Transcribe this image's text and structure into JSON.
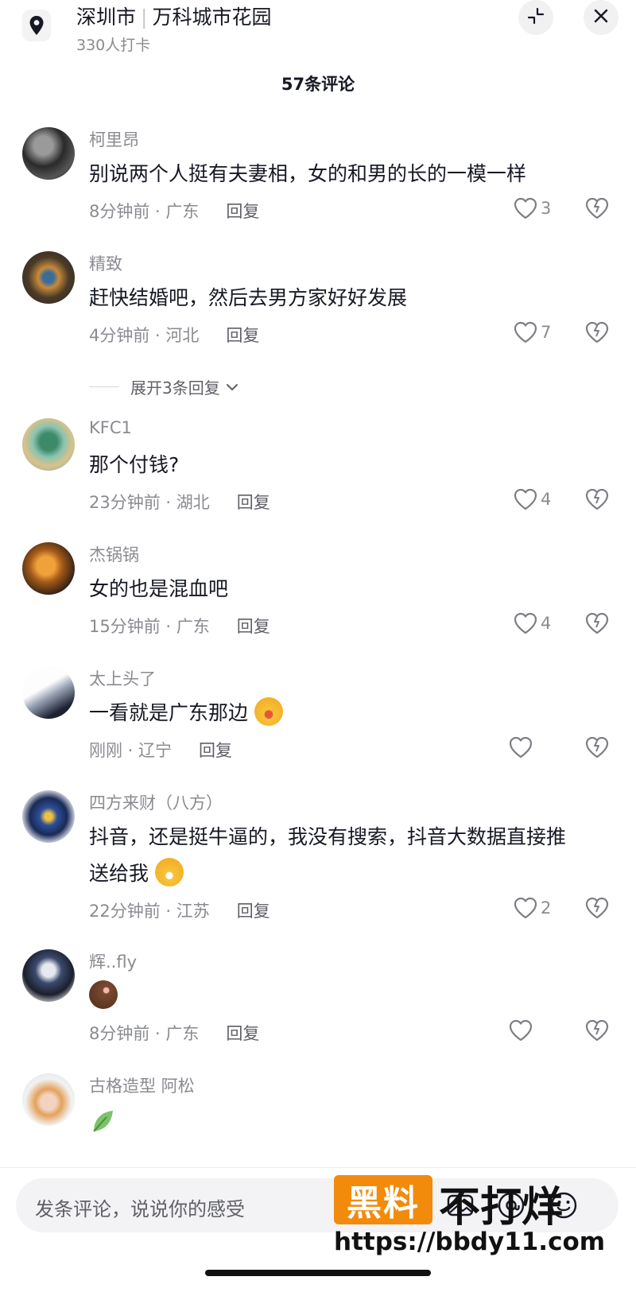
{
  "header": {
    "city": "深圳市",
    "place": "万科城市花园",
    "checkin": "330人打卡",
    "comment_count": "57条评论"
  },
  "comments": [
    {
      "user": "柯里昂",
      "text": "别说两个人挺有夫妻相，女的和男的长的一模一样",
      "time": "8分钟前 · 广东",
      "reply": "回复",
      "likes": "3"
    },
    {
      "user": "精致",
      "text": "赶快结婚吧，然后去男方家好好发展",
      "time": "4分钟前 · 河北",
      "reply": "回复",
      "likes": "7",
      "expand": "展开3条回复"
    },
    {
      "user": "KFC1",
      "text": "那个付钱?",
      "time": "23分钟前 · 湖北",
      "reply": "回复",
      "likes": "4"
    },
    {
      "user": "杰锅锅",
      "text": "女的也是混血吧",
      "time": "15分钟前 · 广东",
      "reply": "回复",
      "likes": "4"
    },
    {
      "user": "太上头了",
      "text": "一看就是广东那边",
      "time": "刚刚 · 辽宁",
      "reply": "回复",
      "likes": ""
    },
    {
      "user": "四方来财（八方）",
      "text": "抖音，还是挺牛逼的，我没有搜索，抖音大数据直接推送给我",
      "time": "22分钟前 · 江苏",
      "reply": "回复",
      "likes": "2"
    },
    {
      "user": "辉..fly",
      "text": "",
      "time": "8分钟前 · 广东",
      "reply": "回复",
      "likes": ""
    },
    {
      "user": "古格造型  阿松",
      "text": "",
      "time": "",
      "reply": "",
      "likes": ""
    }
  ],
  "input": {
    "placeholder": "发条评论，说说你的感受"
  },
  "watermark": {
    "box": "黑料",
    "text": "不打烊",
    "url": "https://bbdy11.com"
  },
  "colors": {
    "text_primary": "#161823",
    "text_secondary": "#8a8b91",
    "watermark_orange": "#f28b0c"
  },
  "icons": [
    "location-pin-icon",
    "collapse-icon",
    "close-icon",
    "heart-icon",
    "dislike-heart-icon",
    "at-icon",
    "emoji-icon"
  ]
}
